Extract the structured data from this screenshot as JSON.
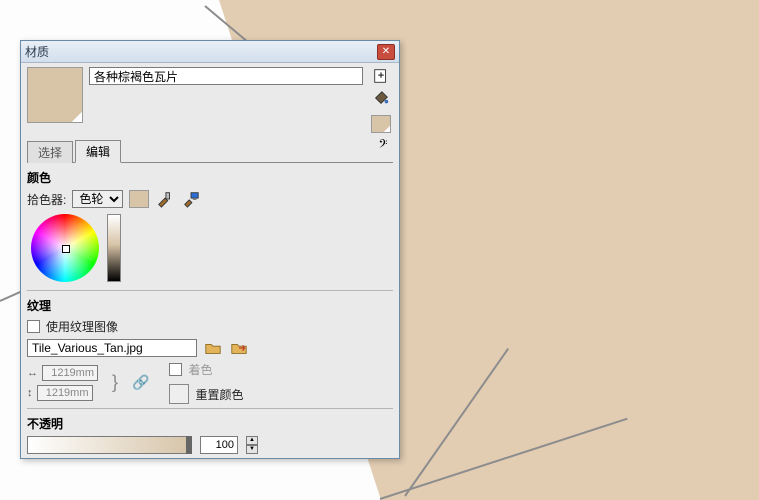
{
  "window": {
    "title": "材质",
    "close_tip": "Close"
  },
  "material": {
    "name": "各种棕褐色瓦片",
    "primary_swatch_hex": "#d8c4a7"
  },
  "side_icons": {
    "add": "Create material",
    "paint": "Paint bucket"
  },
  "tabs": {
    "select": "选择",
    "edit": "编辑"
  },
  "color_section": {
    "heading": "颜色",
    "picker_label": "拾色器:",
    "picker_value": "色轮"
  },
  "texture_section": {
    "heading": "纹理",
    "use_image_label": "使用纹理图像",
    "use_image_checked": false,
    "filename": "Tile_Various_Tan.jpg",
    "width": "1219mm",
    "height": "1219mm",
    "colorize_label": "着色",
    "colorize_checked": false,
    "reset_color_label": "重置颜色"
  },
  "opacity_section": {
    "heading": "不透明",
    "value": "100"
  }
}
